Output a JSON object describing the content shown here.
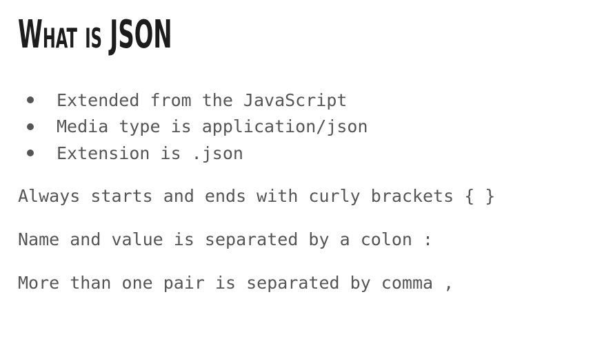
{
  "slide": {
    "title": "What is JSON",
    "bullets": [
      "Extended from the JavaScript",
      "Media type is application/json",
      "Extension is .json"
    ],
    "statements": [
      "Always starts and ends with curly brackets { }",
      "Name and value is separated by a colon :",
      "More than one pair is separated by comma ,"
    ]
  }
}
